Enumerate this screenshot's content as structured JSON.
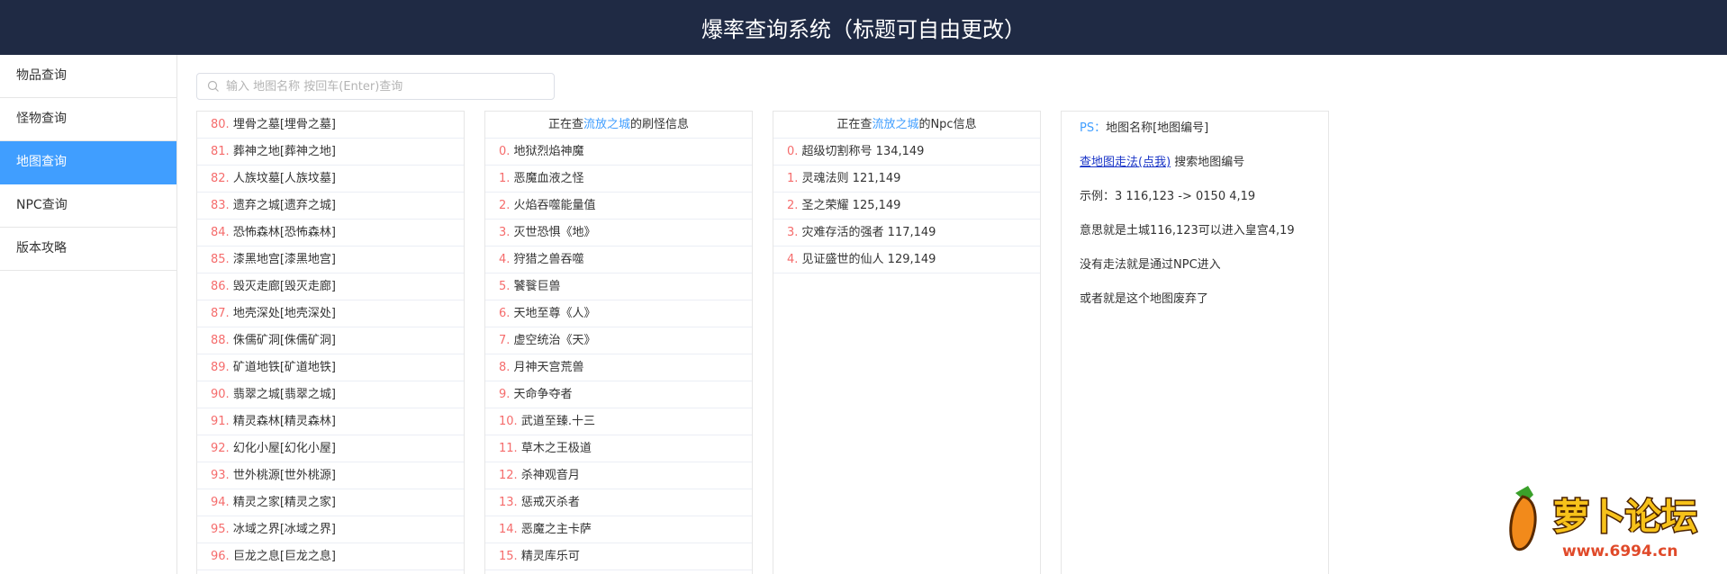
{
  "header": {
    "title": "爆率查询系统（标题可自由更改）"
  },
  "sidebar": {
    "items": [
      {
        "label": "物品查询",
        "active": false
      },
      {
        "label": "怪物查询",
        "active": false
      },
      {
        "label": "地图查询",
        "active": true
      },
      {
        "label": "NPC查询",
        "active": false
      },
      {
        "label": "版本攻略",
        "active": false
      }
    ]
  },
  "search": {
    "placeholder": "输入 地图名称 按回车(Enter)查询",
    "value": ""
  },
  "maps": {
    "rows": [
      {
        "num": "80.",
        "name": "埋骨之墓[埋骨之墓]"
      },
      {
        "num": "81.",
        "name": "葬神之地[葬神之地]"
      },
      {
        "num": "82.",
        "name": "人族坟墓[人族坟墓]"
      },
      {
        "num": "83.",
        "name": "遗弃之城[遗弃之城]"
      },
      {
        "num": "84.",
        "name": "恐怖森林[恐怖森林]"
      },
      {
        "num": "85.",
        "name": "漆黑地宫[漆黑地宫]"
      },
      {
        "num": "86.",
        "name": "毁灭走廊[毁灭走廊]"
      },
      {
        "num": "87.",
        "name": "地壳深处[地壳深处]"
      },
      {
        "num": "88.",
        "name": "侏儒矿洞[侏儒矿洞]"
      },
      {
        "num": "89.",
        "name": "矿道地铁[矿道地铁]"
      },
      {
        "num": "90.",
        "name": "翡翠之城[翡翠之城]"
      },
      {
        "num": "91.",
        "name": "精灵森林[精灵森林]"
      },
      {
        "num": "92.",
        "name": "幻化小屋[幻化小屋]"
      },
      {
        "num": "93.",
        "name": "世外桃源[世外桃源]"
      },
      {
        "num": "94.",
        "name": "精灵之家[精灵之家]"
      },
      {
        "num": "95.",
        "name": "冰域之界[冰域之界]"
      },
      {
        "num": "96.",
        "name": "巨龙之息[巨龙之息]"
      }
    ]
  },
  "monsters": {
    "head_prefix": "正在查",
    "head_map": "流放之城",
    "head_suffix": "的刷怪信息",
    "rows": [
      {
        "num": "0.",
        "name": "地狱烈焰神魔"
      },
      {
        "num": "1.",
        "name": "恶魔血液之怪"
      },
      {
        "num": "2.",
        "name": "火焰吞噬能量值"
      },
      {
        "num": "3.",
        "name": "灭世恐惧《地》"
      },
      {
        "num": "4.",
        "name": "狩猎之兽吞噬"
      },
      {
        "num": "5.",
        "name": "饕餮巨兽"
      },
      {
        "num": "6.",
        "name": "天地至尊《人》"
      },
      {
        "num": "7.",
        "name": "虚空统治《天》"
      },
      {
        "num": "8.",
        "name": "月神天宫荒兽"
      },
      {
        "num": "9.",
        "name": "天命争夺者"
      },
      {
        "num": "10.",
        "name": "武道至臻.十三"
      },
      {
        "num": "11.",
        "name": "草木之王极道"
      },
      {
        "num": "12.",
        "name": "杀神观音月"
      },
      {
        "num": "13.",
        "name": "惩戒灭杀者"
      },
      {
        "num": "14.",
        "name": "恶魔之主卡萨"
      },
      {
        "num": "15.",
        "name": "精灵库乐可"
      }
    ]
  },
  "npcs": {
    "head_prefix": "正在查",
    "head_map": "流放之城",
    "head_suffix": "的Npc信息",
    "rows": [
      {
        "num": "0.",
        "name": "超级切割称号 134,149"
      },
      {
        "num": "1.",
        "name": "灵魂法则 121,149"
      },
      {
        "num": "2.",
        "name": "圣之荣耀 125,149"
      },
      {
        "num": "3.",
        "name": "灾难存活的强者 117,149"
      },
      {
        "num": "4.",
        "name": "见证盛世的仙人 129,149"
      }
    ]
  },
  "help": {
    "ps_label": "PS：",
    "ps_text": "地图名称[地图编号]",
    "link_text": "查地图走法(点我)",
    "link_suffix": " 搜索地图编号",
    "example": "示例：3 116,123 -> 0150 4,19",
    "meaning": "意思就是土城116,123可以进入皇宫4,19",
    "no_path": "没有走法就是通过NPC进入",
    "abandoned": "或者就是这个地图废弃了"
  },
  "watermark": {
    "logo_text": "萝卜论坛",
    "url": "www.6994.cn"
  },
  "colors": {
    "header_bg": "#1f2a44",
    "accent": "#409eff",
    "number": "#f56c6c",
    "link": "#1a35c7"
  }
}
